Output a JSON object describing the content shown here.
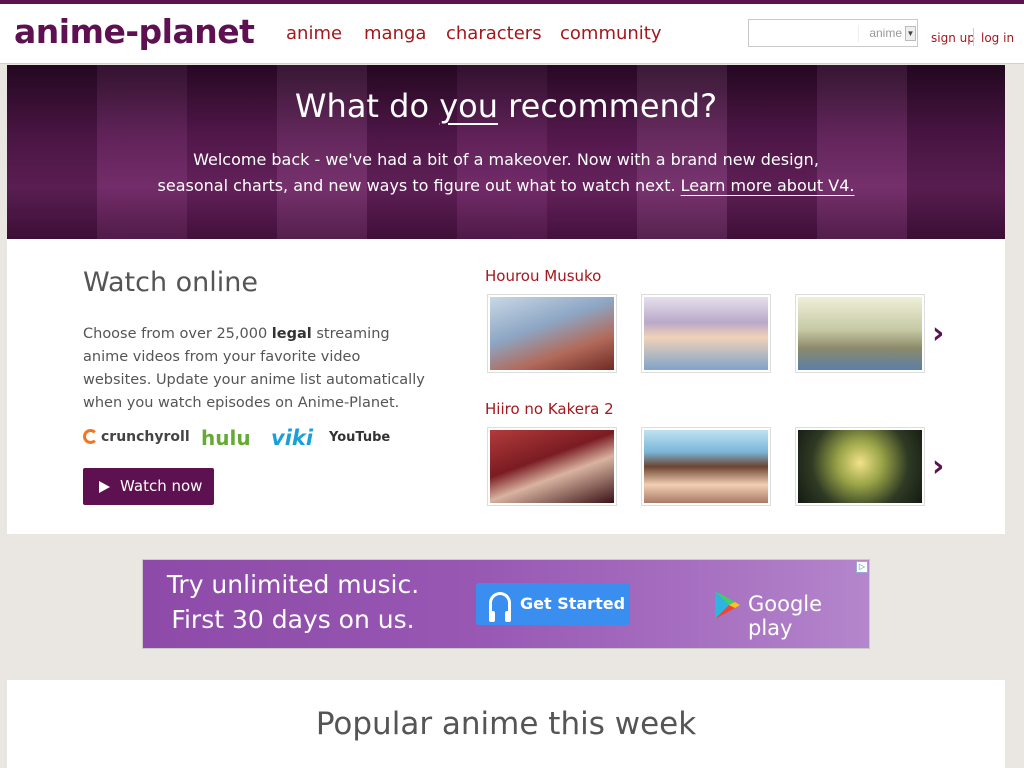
{
  "site": {
    "logo_text": "anime-planet",
    "accent_color": "#5e1150",
    "link_color": "#a3181e"
  },
  "nav": {
    "items": [
      "anime",
      "manga",
      "characters",
      "community"
    ]
  },
  "search": {
    "value": "",
    "type_selected": "anime"
  },
  "user_links": {
    "signup": "sign up",
    "login": "log in"
  },
  "hero": {
    "title_pre": "What do ",
    "title_em": "you",
    "title_post": " recommend?",
    "line1": "Welcome back - we've had a bit of a makeover. Now with a brand new design,",
    "line2_pre": "seasonal charts, and new ways to figure out what to watch next. ",
    "line2_link": "Learn more about V4."
  },
  "watch": {
    "title": "Watch online",
    "desc_pre": "Choose from over 25,000 ",
    "desc_bold": "legal",
    "desc_post": " streaming anime videos from your favorite video websites. Update your anime list automatically when you watch episodes on Anime-Planet.",
    "brands": [
      "crunchyroll",
      "hulu",
      "viki",
      "YouTube"
    ],
    "button_label": "Watch now"
  },
  "series": [
    {
      "title": "Hourou Musuko",
      "thumbs": [
        "Hourou Musuko episode 1",
        "Hourou Musuko episode 2",
        "Hourou Musuko episode 3"
      ]
    },
    {
      "title": "Hiiro no Kakera 2",
      "thumbs": [
        "Hiiro no Kakera 2 episode 1",
        "Hiiro no Kakera 2 episode 2",
        "Hiiro no Kakera 2 episode 3"
      ]
    }
  ],
  "ad": {
    "line1": "Try unlimited music.",
    "line2": "First 30 days on us.",
    "button_label": "Get Started",
    "store_label": "Google play"
  },
  "popular": {
    "title": "Popular anime this week"
  }
}
